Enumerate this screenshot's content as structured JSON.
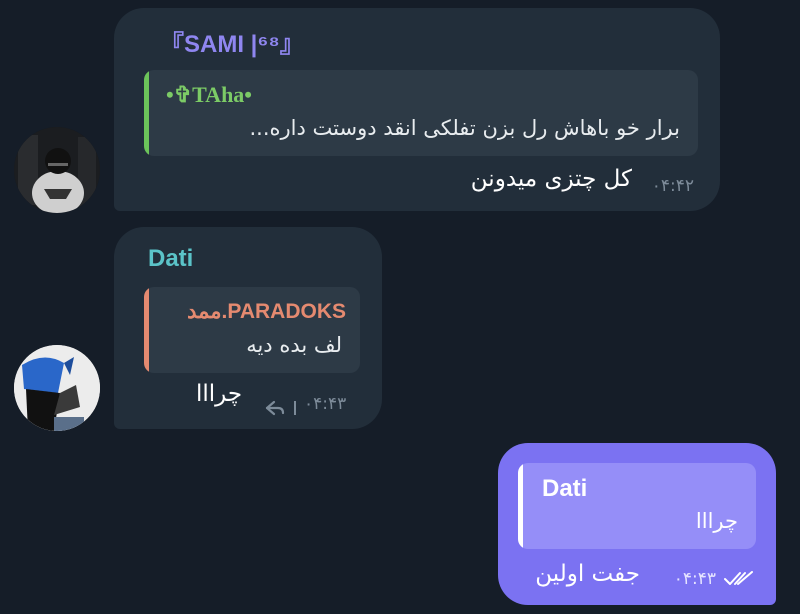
{
  "colors": {
    "background": "#151d28",
    "incoming_bubble": "#222e3a",
    "outgoing_bubble": "#7b72f2",
    "quote_incoming": "#2d3a46",
    "quote_outgoing": "#958ef8"
  },
  "messages": [
    {
      "sender": "『SAMI |⁶⁸』",
      "sender_color": "#8f86f0",
      "reply": {
        "name": "•✞TAha•",
        "name_color": "#7ccb66",
        "bar_color": "#6cc45a",
        "text": "برار خو باهاش رل بزن تفلکی انقد دوستت داره..."
      },
      "text": "کل چتزی میدونن",
      "time": "۰۴:۴۲"
    },
    {
      "sender": "Dati",
      "sender_color": "#5bc3c8",
      "reply": {
        "name": "ممد.PARADOKS",
        "name_color": "#e58a70",
        "bar_color": "#e58a70",
        "text": "لف بده دیه"
      },
      "text": "چرااا",
      "time": "۰۴:۴۳",
      "icon": "reply-arrow-icon"
    },
    {
      "reply": {
        "name": "Dati",
        "name_color": "#ffffff",
        "bar_color": "#ffffff",
        "text": "چرااا"
      },
      "text": "جفت اولین",
      "time": "۰۴:۴۳",
      "icon": "double-check-icon"
    }
  ]
}
